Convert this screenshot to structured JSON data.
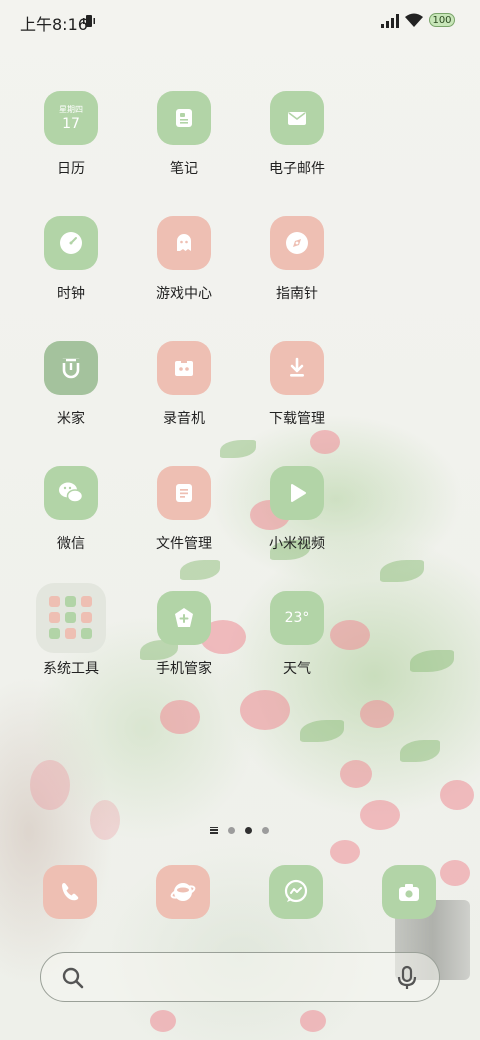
{
  "status_bar": {
    "time": "上午8:16",
    "battery": "100"
  },
  "apps": [
    {
      "label": "日历",
      "weekday": "星期四",
      "day": "17"
    },
    {
      "label": "笔记"
    },
    {
      "label": "电子邮件"
    },
    {
      "label": "时钟"
    },
    {
      "label": "游戏中心"
    },
    {
      "label": "指南针"
    },
    {
      "label": "米家"
    },
    {
      "label": "录音机"
    },
    {
      "label": "下载管理"
    },
    {
      "label": "微信"
    },
    {
      "label": "文件管理"
    },
    {
      "label": "小米视频"
    },
    {
      "label": "系统工具"
    },
    {
      "label": "手机管家"
    },
    {
      "label": "天气",
      "temperature": "23°"
    }
  ],
  "page_indicator": {
    "pages": 3,
    "active": 2
  },
  "dock": [
    "phone-icon",
    "browser-icon",
    "messages-icon",
    "camera-icon"
  ],
  "colors": {
    "icon_green": "#b2d4a7",
    "icon_pink": "#eebfb3",
    "icon_dark_green": "#a4c29d"
  }
}
